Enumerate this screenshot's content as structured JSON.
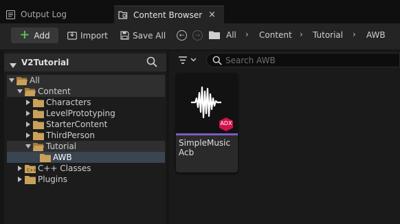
{
  "tabs": {
    "output_log": "Output Log",
    "content_browser": "Content Browser",
    "close_glyph": "×"
  },
  "toolbar": {
    "add_label": "Add",
    "import_label": "Import",
    "save_all_label": "Save All"
  },
  "breadcrumb": [
    "All",
    "Content",
    "Tutorial",
    "AWB"
  ],
  "sources": {
    "title": "V2Tutorial",
    "tree": [
      {
        "label": "All",
        "depth": 0,
        "expanded": true
      },
      {
        "label": "Content",
        "depth": 1,
        "expanded": true
      },
      {
        "label": "Characters",
        "depth": 2,
        "expanded": false
      },
      {
        "label": "LevelPrototyping",
        "depth": 2,
        "expanded": false
      },
      {
        "label": "StarterContent",
        "depth": 2,
        "expanded": false
      },
      {
        "label": "ThirdPerson",
        "depth": 2,
        "expanded": false
      },
      {
        "label": "Tutorial",
        "depth": 2,
        "expanded": true
      },
      {
        "label": "AWB",
        "depth": 3,
        "selected": true
      },
      {
        "label": "C++ Classes",
        "depth": 1,
        "expanded": false
      },
      {
        "label": "Plugins",
        "depth": 1,
        "expanded": false
      }
    ]
  },
  "search": {
    "placeholder": "Search AWB"
  },
  "asset": {
    "name_line1": "SimpleMusic",
    "name_line2": "Acb",
    "badge": "ADX",
    "icon": "audio-waveform-icon",
    "accent_color": "#7a5bc4",
    "badge_color": "#d0124a"
  },
  "colors": {
    "add_plus": "#54c152",
    "folder": "#c9a15a",
    "selection": "#3a4552"
  }
}
